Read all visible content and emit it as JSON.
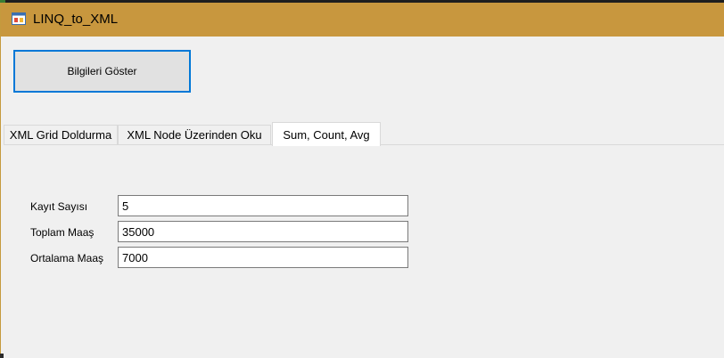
{
  "window": {
    "title": "LINQ_to_XML"
  },
  "actions": {
    "show_button": "Bilgileri Göster"
  },
  "tabs": [
    {
      "label": "XML Grid Doldurma"
    },
    {
      "label": "XML Node Üzerinden Oku"
    },
    {
      "label": "Sum, Count, Avg"
    }
  ],
  "form": {
    "count_label": "Kayıt Sayısı",
    "count_value": "5",
    "total_label": "Toplam Maaş",
    "total_value": "35000",
    "avg_label": "Ortalama Maaş",
    "avg_value": "7000"
  },
  "colors": {
    "titlebar": "#c8973e",
    "focus_border": "#0078d7"
  }
}
